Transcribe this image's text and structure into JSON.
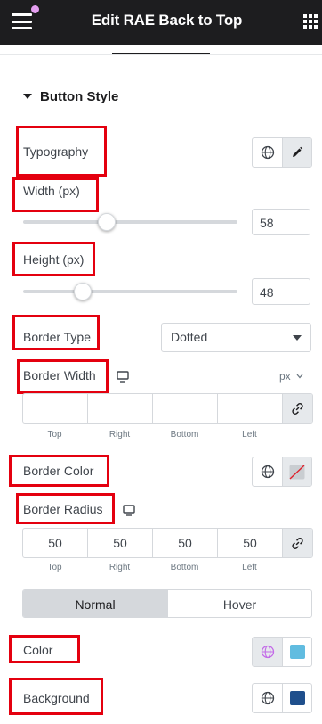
{
  "header": {
    "title": "Edit RAE Back to Top"
  },
  "section": {
    "title": "Button Style"
  },
  "typography": {
    "label": "Typography"
  },
  "width": {
    "label": "Width (px)",
    "value": "58",
    "percent": 0.39
  },
  "height": {
    "label": "Height (px)",
    "value": "48",
    "percent": 0.28
  },
  "border_type": {
    "label": "Border Type",
    "value": "Dotted"
  },
  "border_width": {
    "label": "Border Width",
    "unit": "px",
    "values": [
      "",
      "",
      "",
      ""
    ],
    "sides": [
      "Top",
      "Right",
      "Bottom",
      "Left"
    ]
  },
  "border_color": {
    "label": "Border Color"
  },
  "border_radius": {
    "label": "Border Radius",
    "values": [
      "50",
      "50",
      "50",
      "50"
    ],
    "sides": [
      "Top",
      "Right",
      "Bottom",
      "Left"
    ]
  },
  "state_tabs": {
    "normal": "Normal",
    "hover": "Hover"
  },
  "color": {
    "label": "Color",
    "swatch": "#61bce0"
  },
  "background": {
    "label": "Background",
    "swatch": "#1f4f8c"
  },
  "colors": {
    "highlight": "#e4000f",
    "globe_active": "#c36ae8"
  }
}
